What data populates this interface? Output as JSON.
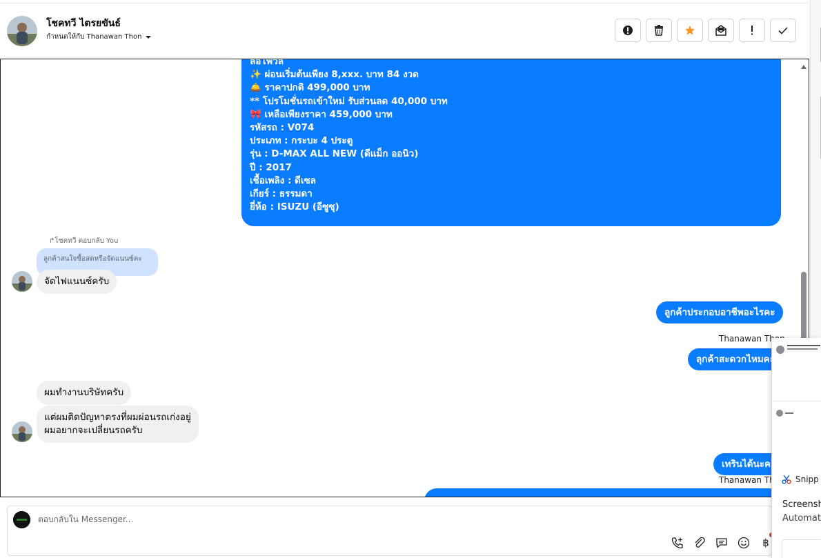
{
  "header": {
    "contact_name": "โชคทวี ไตรยขันธ์",
    "assigned_label": "กำหนดให้กับ Thanawan Thon"
  },
  "long_message": {
    "lines": [
      "ล้อโฟวิล",
      "✨ ผ่อนเริ่มต้นเพียง 8,xxx. บาท 84 งวด",
      "🛎️ ราคาปกติ 499,000 บาท",
      "** โปรโมชั่นรถเข้าใหม่ รับส่วนลด 40,000 บาท",
      "🎀 เหลือเพียงราคา 459,000 บาท",
      "รหัสรถ : V074",
      "ประเภท : กระบะ 4 ประตู",
      "รุ่น : D-MAX ALL NEW (ดีแม็ก ออนิว)",
      "ปี : 2017",
      "เชื้อเพลิง : ดีเซล",
      "เกียร์ : ธรรมดา",
      "ยี่ห้อ : ISUZU (อีซูซุ)"
    ]
  },
  "reply": {
    "meta": "โชคทวี ตอบกลับ You",
    "quoted": "ลูกค้าสนใจซื้อสดหรือจัดแนนซ์คะ",
    "text": "จัดไฟแนนซ์ครับ"
  },
  "messages": {
    "out_job": "ลูกค้าประกอบอาชีพอะไรคะ",
    "sender_1": "Thanawan Thon",
    "out_convenient": "ลุกค้าสะดวกไหมคะ",
    "in_company": "ผมทำงานบริษัทครับ",
    "in_problem_1": "แต่ผมติดปัญหาตรงที่ผมผ่อนรถเก่งอยู่",
    "in_problem_2": "ผมอยากจะเปลี่ยนรถครับ",
    "out_tern": "เทรินได้นะคะ",
    "sender_2": "Thanawan Thon"
  },
  "composer": {
    "placeholder": "ตอบกลับใน Messenger..."
  },
  "snipping": {
    "app_name": "Snipp",
    "notification_title": "Screensh",
    "notification_sub": "Automati"
  },
  "colors": {
    "outgoing_bubble": "#0a7cff",
    "incoming_bubble": "#f0f0f0",
    "quoted_bubble": "#cfe3ff",
    "star": "#f7931e"
  },
  "icons": [
    "report-icon",
    "trash-icon",
    "star-icon",
    "mark-unread-icon",
    "important-icon",
    "done-icon",
    "add-call-icon",
    "attachment-icon",
    "saved-reply-icon",
    "emoji-icon",
    "baht-icon"
  ]
}
